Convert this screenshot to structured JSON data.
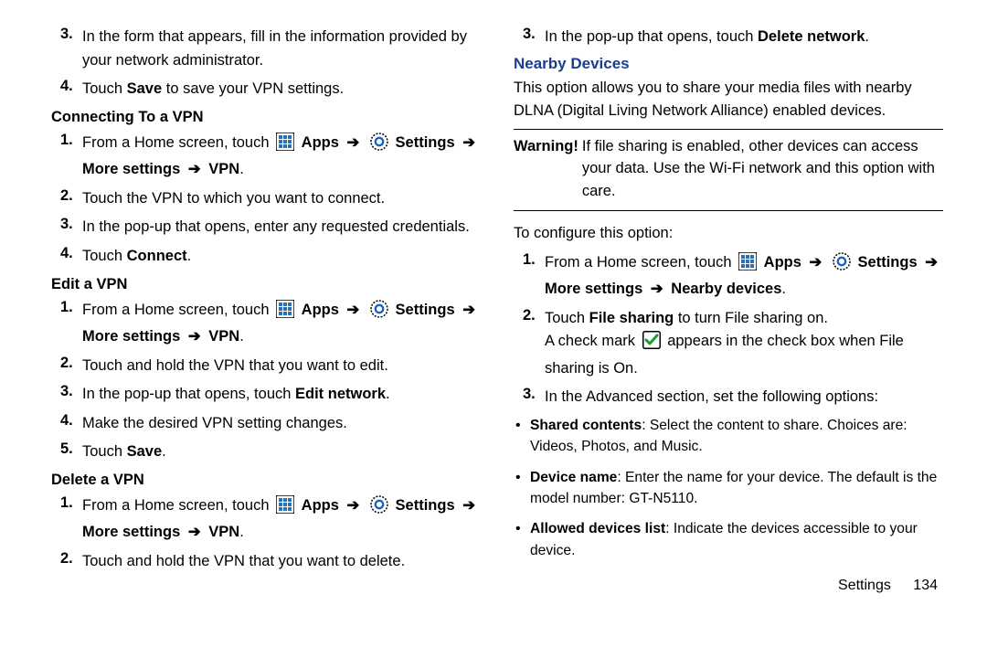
{
  "left": {
    "top_steps": [
      {
        "n": "3.",
        "text": "In the form that appears, fill in the information provided by your network administrator."
      },
      {
        "n": "4.",
        "html": "Touch <b>Save</b> to save your VPN settings."
      }
    ],
    "connect": {
      "title": "Connecting To a VPN",
      "steps": [
        {
          "n": "1.",
          "html": "From a Home screen, touch {APPS} <b>Apps</b> {ARR} {GEAR} <b>Settings</b> {ARR} <b>More settings</b> {ARR} <b>VPN</b>."
        },
        {
          "n": "2.",
          "text": "Touch the VPN to which you want to connect."
        },
        {
          "n": "3.",
          "text": "In the pop-up that opens, enter any requested credentials."
        },
        {
          "n": "4.",
          "html": "Touch <b>Connect</b>."
        }
      ]
    },
    "edit": {
      "title": "Edit a VPN",
      "steps": [
        {
          "n": "1.",
          "html": "From a Home screen, touch {APPS} <b>Apps</b> {ARR} {GEAR} <b>Settings</b> {ARR} <b>More settings</b> {ARR} <b>VPN</b>."
        },
        {
          "n": "2.",
          "text": "Touch and hold the VPN that you want to edit."
        },
        {
          "n": "3.",
          "html": "In the pop-up that opens, touch <b>Edit network</b>."
        },
        {
          "n": "4.",
          "text": "Make the desired VPN setting changes."
        },
        {
          "n": "5.",
          "html": "Touch <b>Save</b>."
        }
      ]
    },
    "delete": {
      "title": "Delete a VPN",
      "steps": [
        {
          "n": "1.",
          "html": "From a Home screen, touch {APPS} <b>Apps</b> {ARR} {GEAR} <b>Settings</b> {ARR} <b>More settings</b> {ARR} <b>VPN</b>."
        },
        {
          "n": "2.",
          "text": "Touch and hold the VPN that you want to delete."
        }
      ]
    }
  },
  "right": {
    "top_step": {
      "n": "3.",
      "html": "In the pop-up that opens, touch <b>Delete network</b>."
    },
    "nearby_title": "Nearby Devices",
    "intro": "This option allows you to share your media files with nearby DLNA (Digital Living Network Alliance) enabled devices.",
    "warning_label": "Warning!",
    "warning_text": "If file sharing is enabled, other devices can access your data. Use the Wi-Fi network and this option with care.",
    "config_intro": "To configure this option:",
    "steps": [
      {
        "n": "1.",
        "html": "From a Home screen, touch {APPS} <b>Apps</b> {ARR} {GEAR} <b>Settings</b> {ARR} <b>More settings</b> {ARR} <b>Nearby devices</b>."
      },
      {
        "n": "2.",
        "html": "Touch <b>File sharing</b> to turn File sharing on.<br>A check mark {CHECK} appears in the check box when File sharing is On."
      },
      {
        "n": "3.",
        "text": "In the Advanced section, set the following options:"
      }
    ],
    "bullets": [
      {
        "html": "<b>Shared contents</b>: Select the content to share. Choices are: Videos, Photos, and Music."
      },
      {
        "html": "<b>Device name</b>: Enter the name for your device. The default is the model number: GT-N5110."
      },
      {
        "html": "<b>Allowed devices list</b>: Indicate the devices accessible to your device."
      }
    ],
    "footer_label": "Settings",
    "footer_page": "134"
  }
}
